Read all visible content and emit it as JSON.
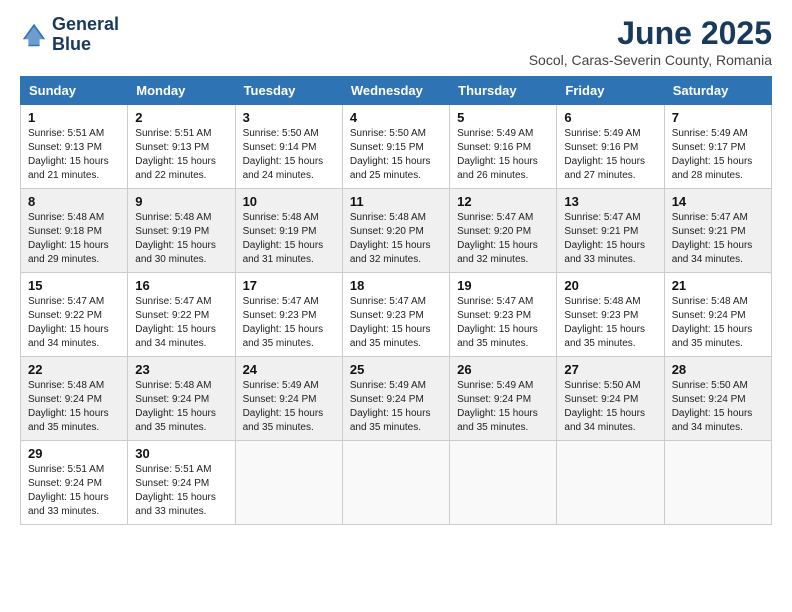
{
  "header": {
    "logo_line1": "General",
    "logo_line2": "Blue",
    "main_title": "June 2025",
    "subtitle": "Socol, Caras-Severin County, Romania"
  },
  "weekdays": [
    "Sunday",
    "Monday",
    "Tuesday",
    "Wednesday",
    "Thursday",
    "Friday",
    "Saturday"
  ],
  "weeks": [
    [
      {
        "day": 1,
        "sunrise": "5:51 AM",
        "sunset": "9:13 PM",
        "daylight": "15 hours and 21 minutes."
      },
      {
        "day": 2,
        "sunrise": "5:51 AM",
        "sunset": "9:13 PM",
        "daylight": "15 hours and 22 minutes."
      },
      {
        "day": 3,
        "sunrise": "5:50 AM",
        "sunset": "9:14 PM",
        "daylight": "15 hours and 24 minutes."
      },
      {
        "day": 4,
        "sunrise": "5:50 AM",
        "sunset": "9:15 PM",
        "daylight": "15 hours and 25 minutes."
      },
      {
        "day": 5,
        "sunrise": "5:49 AM",
        "sunset": "9:16 PM",
        "daylight": "15 hours and 26 minutes."
      },
      {
        "day": 6,
        "sunrise": "5:49 AM",
        "sunset": "9:16 PM",
        "daylight": "15 hours and 27 minutes."
      },
      {
        "day": 7,
        "sunrise": "5:49 AM",
        "sunset": "9:17 PM",
        "daylight": "15 hours and 28 minutes."
      }
    ],
    [
      {
        "day": 8,
        "sunrise": "5:48 AM",
        "sunset": "9:18 PM",
        "daylight": "15 hours and 29 minutes."
      },
      {
        "day": 9,
        "sunrise": "5:48 AM",
        "sunset": "9:19 PM",
        "daylight": "15 hours and 30 minutes."
      },
      {
        "day": 10,
        "sunrise": "5:48 AM",
        "sunset": "9:19 PM",
        "daylight": "15 hours and 31 minutes."
      },
      {
        "day": 11,
        "sunrise": "5:48 AM",
        "sunset": "9:20 PM",
        "daylight": "15 hours and 32 minutes."
      },
      {
        "day": 12,
        "sunrise": "5:47 AM",
        "sunset": "9:20 PM",
        "daylight": "15 hours and 32 minutes."
      },
      {
        "day": 13,
        "sunrise": "5:47 AM",
        "sunset": "9:21 PM",
        "daylight": "15 hours and 33 minutes."
      },
      {
        "day": 14,
        "sunrise": "5:47 AM",
        "sunset": "9:21 PM",
        "daylight": "15 hours and 34 minutes."
      }
    ],
    [
      {
        "day": 15,
        "sunrise": "5:47 AM",
        "sunset": "9:22 PM",
        "daylight": "15 hours and 34 minutes."
      },
      {
        "day": 16,
        "sunrise": "5:47 AM",
        "sunset": "9:22 PM",
        "daylight": "15 hours and 34 minutes."
      },
      {
        "day": 17,
        "sunrise": "5:47 AM",
        "sunset": "9:23 PM",
        "daylight": "15 hours and 35 minutes."
      },
      {
        "day": 18,
        "sunrise": "5:47 AM",
        "sunset": "9:23 PM",
        "daylight": "15 hours and 35 minutes."
      },
      {
        "day": 19,
        "sunrise": "5:47 AM",
        "sunset": "9:23 PM",
        "daylight": "15 hours and 35 minutes."
      },
      {
        "day": 20,
        "sunrise": "5:48 AM",
        "sunset": "9:23 PM",
        "daylight": "15 hours and 35 minutes."
      },
      {
        "day": 21,
        "sunrise": "5:48 AM",
        "sunset": "9:24 PM",
        "daylight": "15 hours and 35 minutes."
      }
    ],
    [
      {
        "day": 22,
        "sunrise": "5:48 AM",
        "sunset": "9:24 PM",
        "daylight": "15 hours and 35 minutes."
      },
      {
        "day": 23,
        "sunrise": "5:48 AM",
        "sunset": "9:24 PM",
        "daylight": "15 hours and 35 minutes."
      },
      {
        "day": 24,
        "sunrise": "5:49 AM",
        "sunset": "9:24 PM",
        "daylight": "15 hours and 35 minutes."
      },
      {
        "day": 25,
        "sunrise": "5:49 AM",
        "sunset": "9:24 PM",
        "daylight": "15 hours and 35 minutes."
      },
      {
        "day": 26,
        "sunrise": "5:49 AM",
        "sunset": "9:24 PM",
        "daylight": "15 hours and 35 minutes."
      },
      {
        "day": 27,
        "sunrise": "5:50 AM",
        "sunset": "9:24 PM",
        "daylight": "15 hours and 34 minutes."
      },
      {
        "day": 28,
        "sunrise": "5:50 AM",
        "sunset": "9:24 PM",
        "daylight": "15 hours and 34 minutes."
      }
    ],
    [
      {
        "day": 29,
        "sunrise": "5:51 AM",
        "sunset": "9:24 PM",
        "daylight": "15 hours and 33 minutes."
      },
      {
        "day": 30,
        "sunrise": "5:51 AM",
        "sunset": "9:24 PM",
        "daylight": "15 hours and 33 minutes."
      },
      null,
      null,
      null,
      null,
      null
    ]
  ]
}
